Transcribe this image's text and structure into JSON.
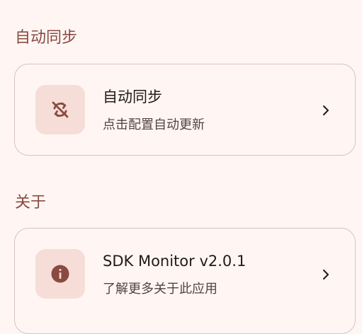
{
  "sections": [
    {
      "header": "自动同步",
      "item": {
        "icon": "sync-disabled-icon",
        "title": "自动同步",
        "subtitle": "点击配置自动更新"
      }
    },
    {
      "header": "关于",
      "item": {
        "icon": "info-icon",
        "title": "SDK Monitor v2.0.1",
        "subtitle": "了解更多关于此应用"
      }
    }
  ],
  "colors": {
    "background": "#FFF6F4",
    "accent": "#8A4A3F",
    "icon_container": "#F6DDD8",
    "card_border": "#D8C2BD"
  }
}
